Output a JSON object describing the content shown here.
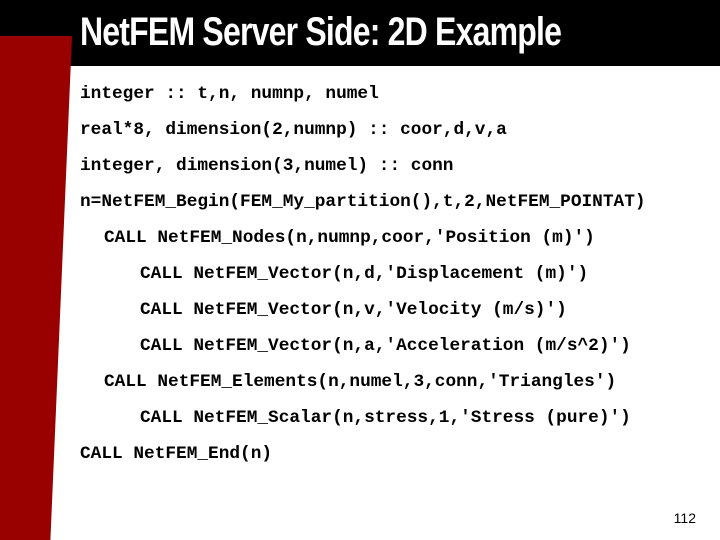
{
  "slide": {
    "title": "NetFEM Server Side: 2D Example",
    "page_number": "112",
    "colors": {
      "header_background": "#000000",
      "title_text": "#ffffff",
      "accent_bar": "#990000",
      "body_background": "#ffffff",
      "code_text": "#000000"
    },
    "code_lines": [
      {
        "indent": 0,
        "text": "integer :: t,n, numnp, numel"
      },
      {
        "indent": 0,
        "text": "real*8, dimension(2,numnp) :: coor,d,v,a"
      },
      {
        "indent": 0,
        "text": "integer, dimension(3,numel) :: conn"
      },
      {
        "indent": 0,
        "text": "n=NetFEM_Begin(FEM_My_partition(),t,2,NetFEM_POINTAT)"
      },
      {
        "indent": 1,
        "text": "CALL NetFEM_Nodes(n,numnp,coor,'Position (m)')"
      },
      {
        "indent": 2,
        "text": "CALL NetFEM_Vector(n,d,'Displacement (m)')"
      },
      {
        "indent": 2,
        "text": "CALL NetFEM_Vector(n,v,'Velocity (m/s)')"
      },
      {
        "indent": 2,
        "text": "CALL NetFEM_Vector(n,a,'Acceleration (m/s^2)')"
      },
      {
        "indent": 1,
        "text": "CALL NetFEM_Elements(n,numel,3,conn,'Triangles')"
      },
      {
        "indent": 2,
        "text": "CALL NetFEM_Scalar(n,stress,1,'Stress (pure)')"
      },
      {
        "indent": 0,
        "text": "CALL NetFEM_End(n)"
      }
    ]
  }
}
